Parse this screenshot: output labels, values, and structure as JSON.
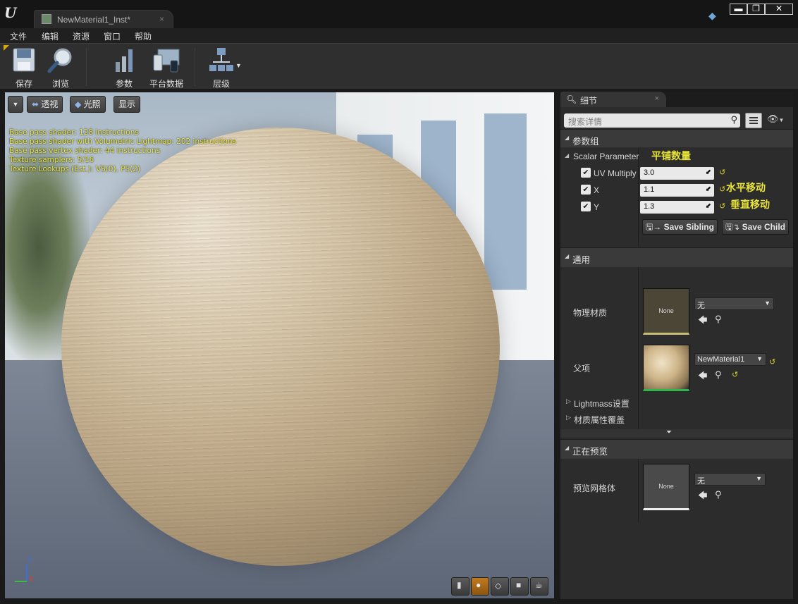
{
  "window": {
    "tab_title": "NewMaterial1_Inst*",
    "tab_close": "×",
    "minimize": "▬",
    "maximize": "❐",
    "close": "✕"
  },
  "menu": [
    "文件",
    "编辑",
    "资源",
    "窗口",
    "帮助"
  ],
  "toolbar": {
    "save": "保存",
    "browse": "浏览",
    "params": "参数",
    "platform": "平台数据",
    "hierarchy": "层级"
  },
  "viewport": {
    "perspective": "透视",
    "lit": "光照",
    "show": "显示",
    "stats": [
      "Base pass shader: 128 instructions",
      "Base pass shader with Volumetric Lightmap: 202 instructions",
      "Base pass vertex shader: 44 instructions",
      "Texture samplers: 5/16",
      "Texture Lookups (Est.): VS(0), PS(2)"
    ],
    "axis_z": "Z",
    "axis_x": "X"
  },
  "details": {
    "tab": "细节",
    "search_placeholder": "搜索详情",
    "param_group": "参数组",
    "scalar_param": "Scalar Parameter",
    "params": [
      {
        "name": "UV Multiply",
        "value": "3.0",
        "note": "平铺数量"
      },
      {
        "name": "X",
        "value": "1.1",
        "note": "水平移动"
      },
      {
        "name": "Y",
        "value": "1.3",
        "note": "垂直移动"
      }
    ],
    "save_sibling": "Save Sibling",
    "save_child": "Save Child",
    "general": "通用",
    "phys_material": "物理材质",
    "phys_value": "无",
    "none": "None",
    "parent": "父项",
    "parent_value": "NewMaterial1",
    "lightmass": "Lightmass设置",
    "mat_override": "材质属性覆盖",
    "previewing": "正在预览",
    "preview_mesh": "预览网格体",
    "preview_value": "无"
  },
  "colors": {
    "annotation": "#e8e43a",
    "accent": "#d8a900"
  }
}
